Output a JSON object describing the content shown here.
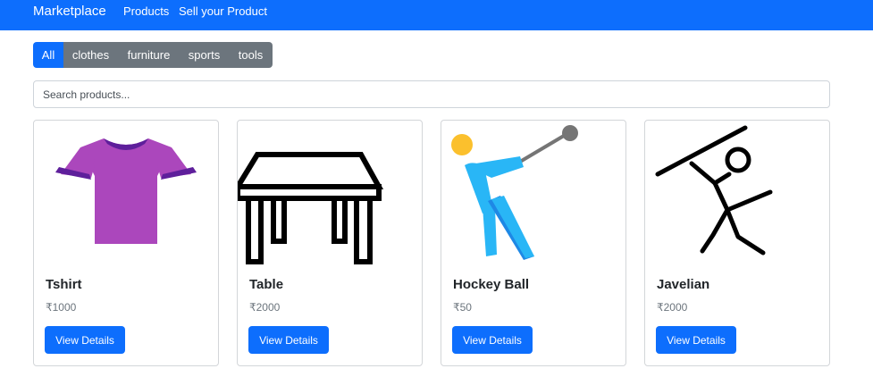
{
  "navbar": {
    "brand": "Marketplace",
    "links": [
      "Products",
      "Sell your Product"
    ],
    "background": "#0d6efd"
  },
  "categories": [
    {
      "label": "All",
      "active": true
    },
    {
      "label": "clothes",
      "active": false
    },
    {
      "label": "furniture",
      "active": false
    },
    {
      "label": "sports",
      "active": false
    },
    {
      "label": "tools",
      "active": false
    }
  ],
  "search": {
    "value": "",
    "placeholder": "Search products..."
  },
  "products": [
    {
      "name": "Tshirt",
      "price": "₹1000",
      "button": "View Details",
      "icon": "tshirt-icon"
    },
    {
      "name": "Table",
      "price": "₹2000",
      "button": "View Details",
      "icon": "table-icon"
    },
    {
      "name": "Hockey Ball",
      "price": "₹50",
      "button": "View Details",
      "icon": "hammer-throw-icon"
    },
    {
      "name": "Javelian",
      "price": "₹2000",
      "button": "View Details",
      "icon": "javelin-thrower-icon"
    }
  ],
  "colors": {
    "primary": "#0d6efd",
    "secondary": "#6c757d",
    "tshirt": "#ab47bc",
    "tshirt_trim": "#5e1f9b",
    "athlete": "#29b6f6",
    "ball": "#fbc02d"
  }
}
